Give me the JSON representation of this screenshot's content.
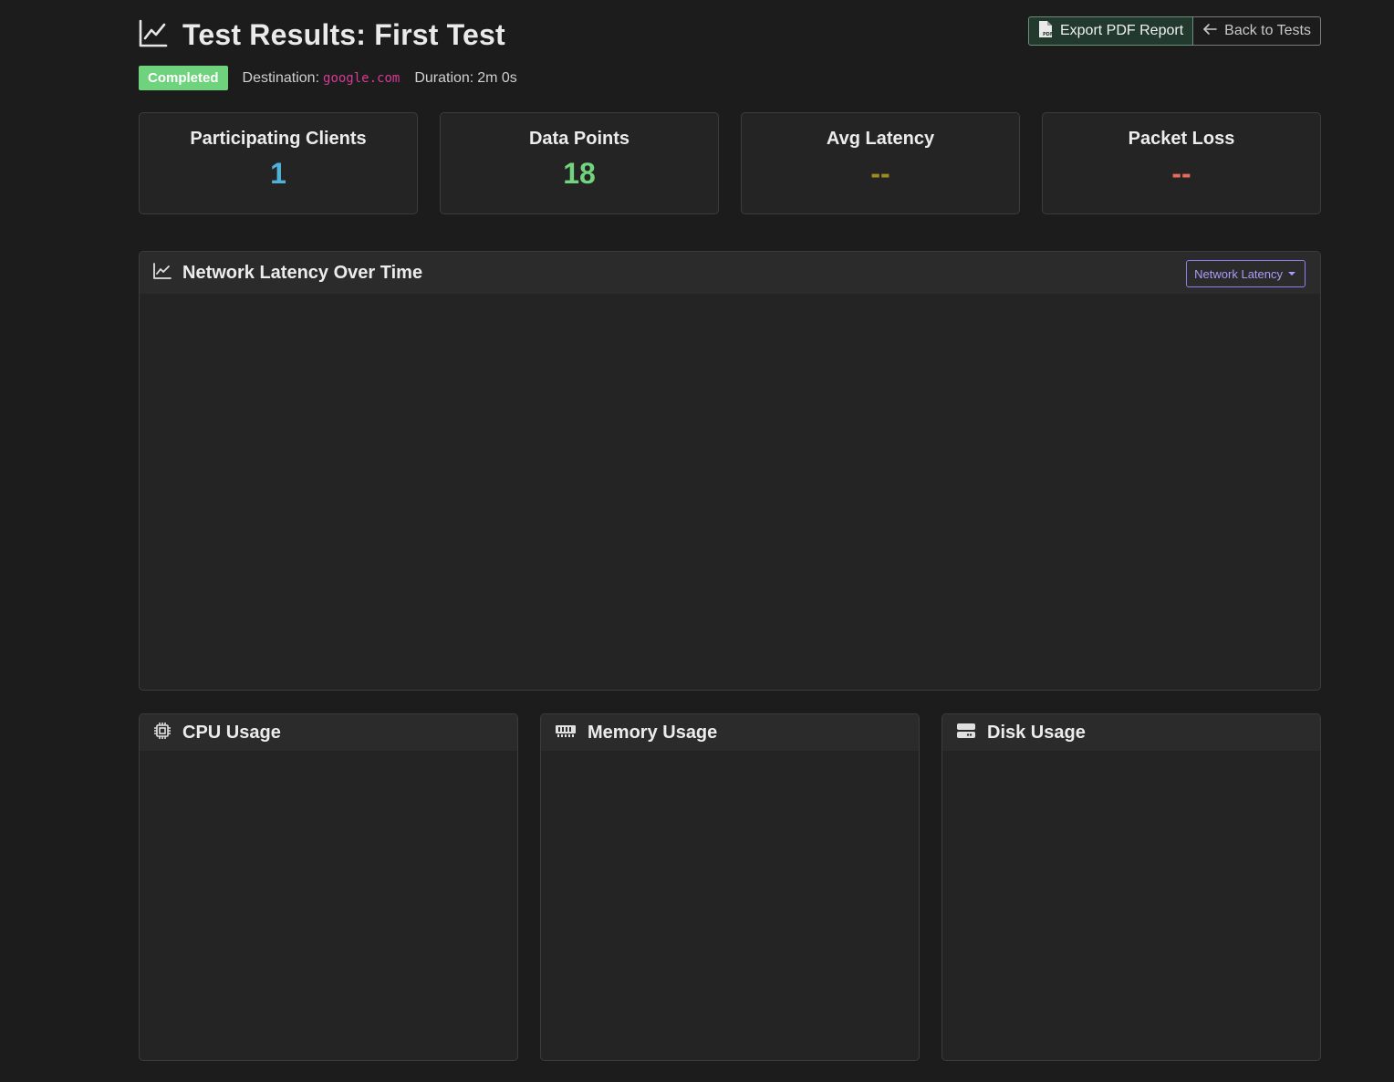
{
  "header": {
    "title": "Test Results: First Test",
    "title_icon": "line-chart-icon",
    "export_label": "Export PDF Report",
    "export_icon": "pdf-file-icon",
    "back_label": "Back to Tests",
    "back_icon": "arrow-left-icon"
  },
  "meta": {
    "status": "Completed",
    "destination_label": "Destination:",
    "destination_value": "google.com",
    "duration_label": "Duration:",
    "duration_value": "2m 0s"
  },
  "stats": [
    {
      "label": "Participating Clients",
      "value": "1",
      "color": "#4fb3d9"
    },
    {
      "label": "Data Points",
      "value": "18",
      "color": "#72d47f"
    },
    {
      "label": "Avg Latency",
      "value": "--",
      "color": "#a08c1e"
    },
    {
      "label": "Packet Loss",
      "value": "--",
      "color": "#e66b5b"
    }
  ],
  "latency_panel": {
    "title": "Network Latency Over Time",
    "icon": "line-chart-icon",
    "dropdown_label": "Network Latency"
  },
  "resource_panels": [
    {
      "title": "CPU Usage",
      "icon": "cpu-icon"
    },
    {
      "title": "Memory Usage",
      "icon": "memory-icon"
    },
    {
      "title": "Disk Usage",
      "icon": "disk-icon"
    }
  ],
  "colors": {
    "background": "#1c1c1c",
    "card": "#242424",
    "status_completed": "#6fd27d",
    "destination": "#d63a94",
    "accent": "#8f7ff0"
  }
}
